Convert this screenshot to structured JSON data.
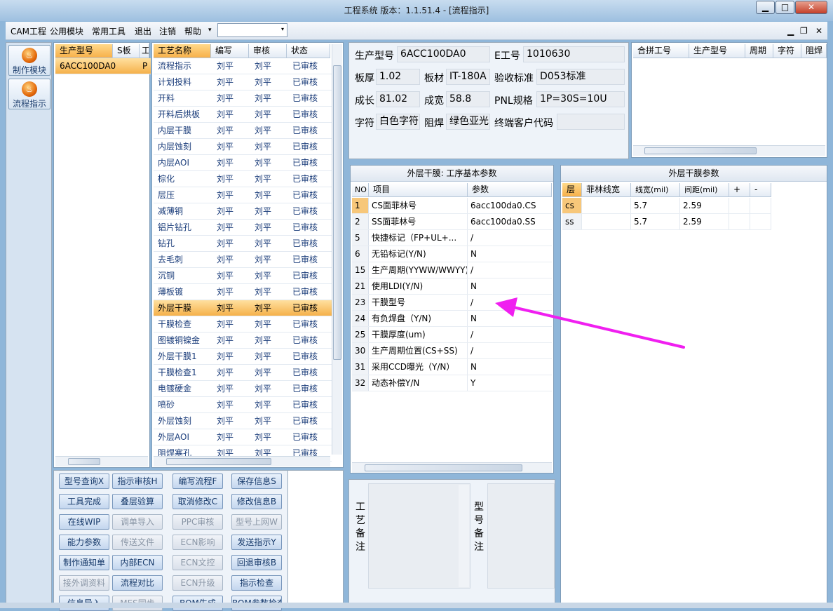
{
  "window": {
    "title": "工程系统  版本：1.1.51.4 - [流程指示]",
    "min": "▁",
    "max": "□",
    "close": "✕"
  },
  "menu": {
    "items": [
      "CAM工程",
      "公用模块",
      "常用工具",
      "退出",
      "注销",
      "帮助"
    ],
    "help_arrow": "▾",
    "combo_arrow": "▾",
    "mdi": [
      "▁",
      "❐",
      "✕"
    ]
  },
  "nav": {
    "items": [
      {
        "label": "制作模块",
        "icon": "flame-icon"
      },
      {
        "label": "流程指示",
        "icon": "flame-icon"
      }
    ],
    "icon_glyph": "♨"
  },
  "model_list": {
    "headers": [
      "生产型号",
      "S板",
      "工"
    ],
    "rows": [
      [
        "6ACC100DA0",
        "P"
      ]
    ]
  },
  "process": {
    "headers": [
      "工艺名称",
      "编写",
      "审核",
      "状态"
    ],
    "rows": [
      [
        "流程指示",
        "刘平",
        "刘平",
        "已审核"
      ],
      [
        "计划投料",
        "刘平",
        "刘平",
        "已审核"
      ],
      [
        "开料",
        "刘平",
        "刘平",
        "已审核"
      ],
      [
        "开料后烘板",
        "刘平",
        "刘平",
        "已审核"
      ],
      [
        "内层干膜",
        "刘平",
        "刘平",
        "已审核"
      ],
      [
        "内层蚀刻",
        "刘平",
        "刘平",
        "已审核"
      ],
      [
        "内层AOI",
        "刘平",
        "刘平",
        "已审核"
      ],
      [
        "棕化",
        "刘平",
        "刘平",
        "已审核"
      ],
      [
        "层压",
        "刘平",
        "刘平",
        "已审核"
      ],
      [
        "减薄铜",
        "刘平",
        "刘平",
        "已审核"
      ],
      [
        "铝片钻孔",
        "刘平",
        "刘平",
        "已审核"
      ],
      [
        "钻孔",
        "刘平",
        "刘平",
        "已审核"
      ],
      [
        "去毛刺",
        "刘平",
        "刘平",
        "已审核"
      ],
      [
        "沉铜",
        "刘平",
        "刘平",
        "已审核"
      ],
      [
        "薄板镀",
        "刘平",
        "刘平",
        "已审核"
      ],
      [
        "外层干膜",
        "刘平",
        "刘平",
        "已审核"
      ],
      [
        "干膜检查",
        "刘平",
        "刘平",
        "已审核"
      ],
      [
        "图镀铜镍金",
        "刘平",
        "刘平",
        "已审核"
      ],
      [
        "外层干膜1",
        "刘平",
        "刘平",
        "已审核"
      ],
      [
        "干膜检查1",
        "刘平",
        "刘平",
        "已审核"
      ],
      [
        "电镀硬金",
        "刘平",
        "刘平",
        "已审核"
      ],
      [
        "喷砂",
        "刘平",
        "刘平",
        "已审核"
      ],
      [
        "外层蚀刻",
        "刘平",
        "刘平",
        "已审核"
      ],
      [
        "外层AOI",
        "刘平",
        "刘平",
        "已审核"
      ],
      [
        "阻焊塞孔",
        "刘平",
        "刘平",
        "已审核"
      ]
    ],
    "selected_index": 15
  },
  "buttons": [
    [
      "型号查询X",
      "指示审核H",
      "编写流程F",
      "保存信息S"
    ],
    [
      "工具完成",
      "叠层验算",
      "取消修改C",
      "修改信息B"
    ],
    [
      "在线WIP",
      "调单导入",
      "PPC审核",
      "型号上网W"
    ],
    [
      "能力参数",
      "传送文件",
      "ECN影响",
      "发送指示Y"
    ],
    [
      "制作通知单",
      "内部ECN",
      "ECN文控",
      "回退审核B"
    ],
    [
      "接外调资料",
      "流程对比",
      "ECN升级",
      "指示检查"
    ],
    [
      "信息导入",
      "MES同步",
      "BOM生成",
      "BOM参数检查"
    ]
  ],
  "buttons_disabled": [
    [],
    [],
    [
      1,
      2,
      3
    ],
    [
      1,
      2
    ],
    [
      2
    ],
    [
      0,
      2
    ],
    [
      1
    ]
  ],
  "info": {
    "model_label": "生产型号",
    "model": "6ACC100DA0",
    "e_label": "E工号",
    "e_no": "1010630",
    "thick_label": "板厚",
    "thick": "1.02",
    "material_label": "板材",
    "material": "IT-180A",
    "accept_label": "验收标准",
    "accept": "D053标准",
    "len_label": "成长",
    "len": "81.02",
    "wid_label": "成宽",
    "wid": "58.8",
    "pnl_label": "PNL规格",
    "pnl": "1P=30S=10U",
    "char_label": "字符",
    "char": "白色字符",
    "mask_label": "阻焊",
    "mask": "绿色亚光",
    "cust_label": "终端客户代码",
    "cust": ""
  },
  "merge": {
    "headers": [
      "合拼工号",
      "生产型号",
      "周期",
      "字符",
      "阻焊"
    ]
  },
  "params": {
    "title": "外层干膜: 工序基本参数",
    "headers": [
      "NO",
      "项目",
      "参数"
    ],
    "rows": [
      [
        "1",
        "CS面菲林号",
        "6acc100da0.CS"
      ],
      [
        "2",
        "SS面菲林号",
        "6acc100da0.SS"
      ],
      [
        "5",
        "快捷标记（FP+UL+...",
        "/"
      ],
      [
        "6",
        "无铅标记(Y/N)",
        "N"
      ],
      [
        "15",
        "生产周期(YYWW/WWYY)",
        "/"
      ],
      [
        "21",
        "使用LDI(Y/N)",
        "N"
      ],
      [
        "23",
        "干膜型号",
        "/"
      ],
      [
        "24",
        "有负焊盘（Y/N)",
        "N"
      ],
      [
        "25",
        "干膜厚度(um)",
        "/"
      ],
      [
        "30",
        "生产周期位置(CS+SS)",
        "/"
      ],
      [
        "31",
        "采用CCD曝光（Y/N）",
        "N"
      ],
      [
        "32",
        "动态补偿Y/N",
        "Y"
      ]
    ]
  },
  "dryfilm": {
    "title": "外层干膜参数",
    "headers": [
      "层",
      "菲林线宽",
      "线宽(mil)",
      "间距(mil)",
      "+",
      "-"
    ],
    "rows": [
      [
        "cs",
        "",
        "5.7",
        "2.59"
      ],
      [
        "ss",
        "",
        "5.7",
        "2.59"
      ]
    ]
  },
  "notes": {
    "craft_label": "工艺备注",
    "model_label": "型号备注"
  },
  "annotation_color": "#f01ff0"
}
